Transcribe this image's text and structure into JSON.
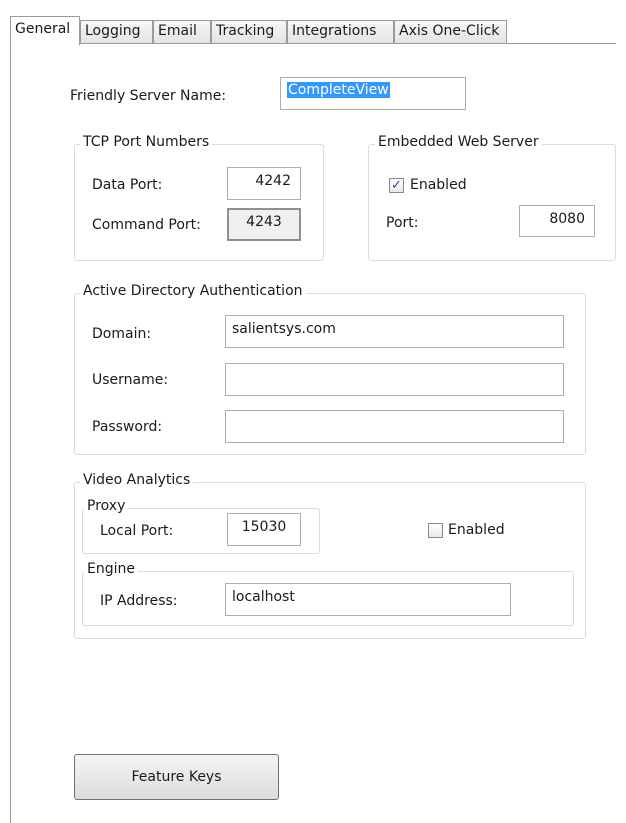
{
  "tabs": [
    "General",
    "Logging",
    "Email",
    "Tracking",
    "Integrations",
    "Axis One-Click"
  ],
  "general": {
    "friendly_server_name_label": "Friendly Server Name:",
    "friendly_server_name_value": "CompleteView"
  },
  "tcp_ports": {
    "title": "TCP Port Numbers",
    "data_port_label": "Data Port:",
    "data_port_value": "4242",
    "command_port_label": "Command Port:",
    "command_port_value": "4243"
  },
  "web_server": {
    "title": "Embedded Web Server",
    "enabled_label": "Enabled",
    "enabled_checked": true,
    "port_label": "Port:",
    "port_value": "8080"
  },
  "active_directory": {
    "title": "Active Directory Authentication",
    "domain_label": "Domain:",
    "domain_value": "salientsys.com",
    "username_label": "Username:",
    "username_value": "",
    "password_label": "Password:",
    "password_value": ""
  },
  "video_analytics": {
    "title": "Video Analytics",
    "proxy_title": "Proxy",
    "local_port_label": "Local Port:",
    "local_port_value": "15030",
    "enabled_label": "Enabled",
    "enabled_checked": false,
    "engine_title": "Engine",
    "ip_address_label": "IP Address:",
    "ip_address_value": "localhost"
  },
  "feature_keys_label": "Feature Keys",
  "colors": {
    "selection": "#3399ff",
    "border": "#9a9a9a",
    "group_border": "#dcdcdc"
  }
}
